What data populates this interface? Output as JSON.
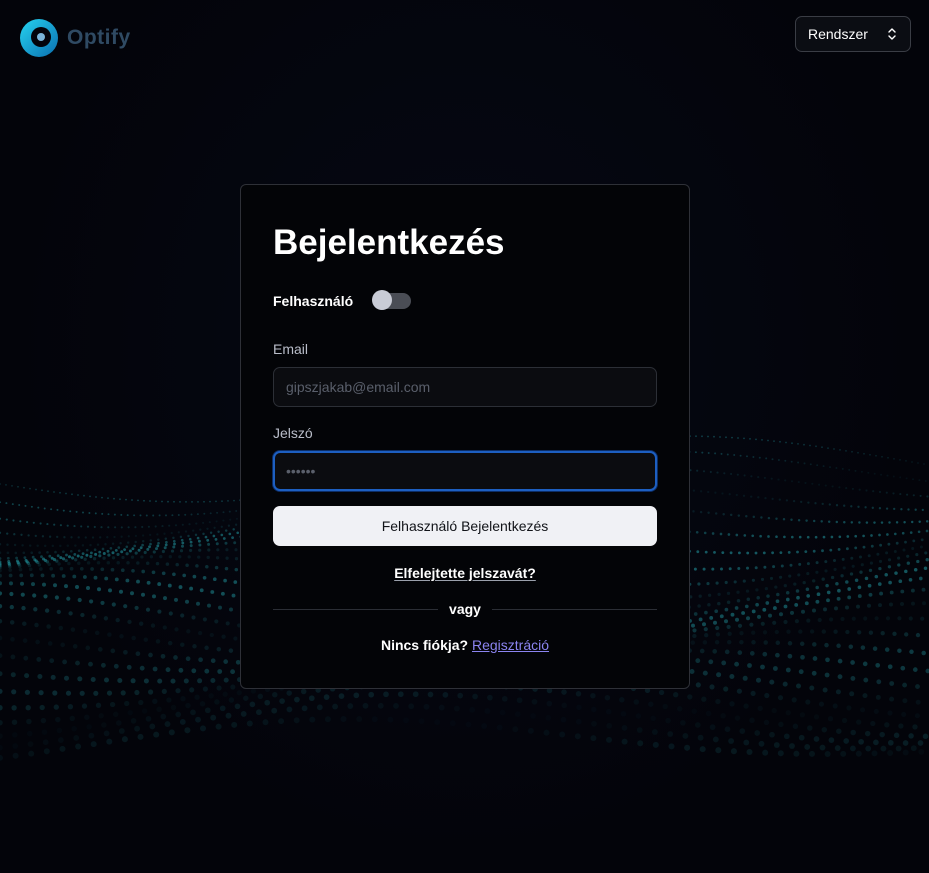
{
  "header": {
    "logo_text": "Optify",
    "theme_select": {
      "value": "Rendszer"
    }
  },
  "login": {
    "title": "Bejelentkezés",
    "mode_switch_label": "Felhasználó",
    "mode_switch_on": false,
    "email": {
      "label": "Email",
      "placeholder": "gipszjakab@email.com",
      "value": ""
    },
    "password": {
      "label": "Jelszó",
      "placeholder": "••••••",
      "value": ""
    },
    "submit_label": "Felhasználó Bejelentkezés",
    "forgot_password": "Elfelejtette jelszavát?",
    "divider_text": "vagy",
    "no_account_text": "Nincs fiókja?",
    "register_link": "Regisztráció"
  },
  "colors": {
    "background": "#04050b",
    "card_background": "#030407",
    "accent_focus": "#1d5fc1",
    "link": "#8b84f0",
    "logo_cyan": "#1ec3e8",
    "wave_dots": "#1f8a93"
  },
  "icons": {
    "logo": "optify-logo-icon",
    "select": "chevron-up-down-icon"
  }
}
